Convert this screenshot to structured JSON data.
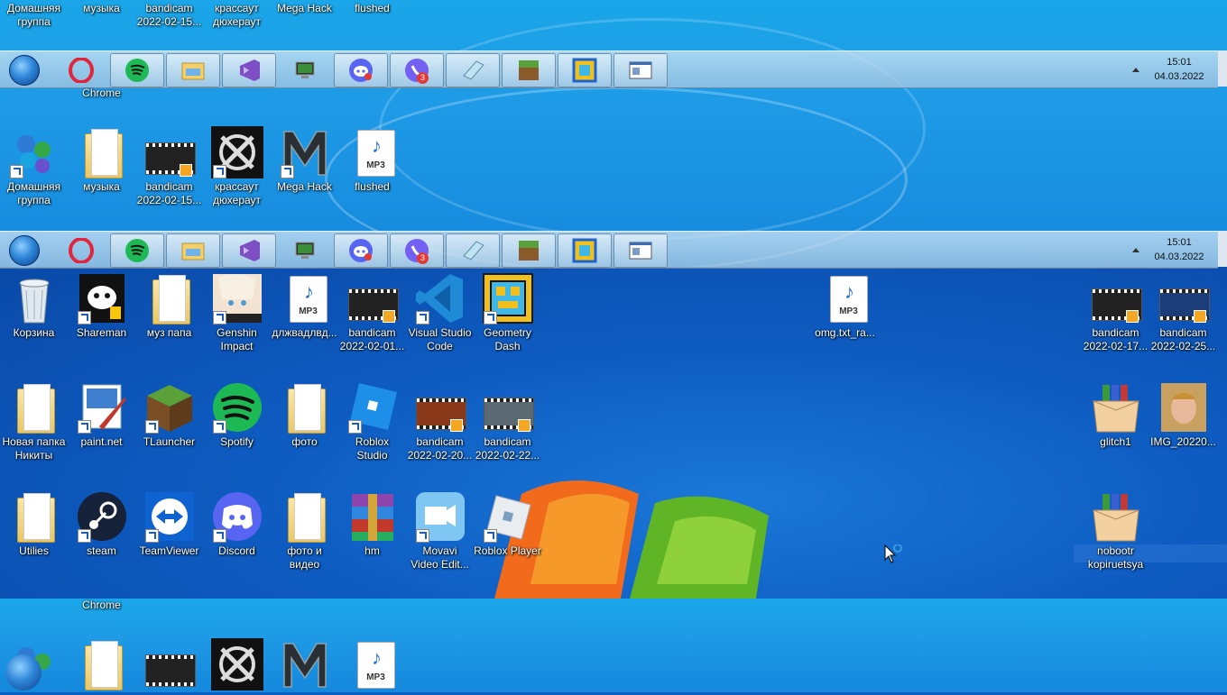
{
  "taskbar": {
    "clock_time": "15:01",
    "clock_date": "04.03.2022",
    "apps": [
      {
        "name": "opera-icon",
        "badge": ""
      },
      {
        "name": "spotify-icon",
        "badge": ""
      },
      {
        "name": "file-explorer-icon",
        "badge": ""
      },
      {
        "name": "visual-studio-icon",
        "badge": ""
      },
      {
        "name": "network-monitor-icon",
        "badge": ""
      },
      {
        "name": "discord-icon",
        "badge": ""
      },
      {
        "name": "viber-icon",
        "badge": "3"
      },
      {
        "name": "notepad-icon",
        "badge": ""
      },
      {
        "name": "minecraft-icon",
        "badge": ""
      },
      {
        "name": "geometry-dash-icon",
        "badge": ""
      },
      {
        "name": "window-app-icon",
        "badge": ""
      }
    ]
  },
  "ghost_top_labels": [
    "Домашняя\nгруппа",
    "музыка",
    "bandicam\n2022-02-15...",
    "крассаут\nдюхераут",
    "Mega Hack",
    "flushed"
  ],
  "ghost_chrome_label": "Chrome",
  "desktop": {
    "row1": [
      {
        "label": "Корзина",
        "icon": "recycle-bin-icon"
      },
      {
        "label": "Shareman",
        "icon": "shareman-icon"
      },
      {
        "label": "муз папа",
        "icon": "folder-icon"
      },
      {
        "label": "Genshin\nImpact",
        "icon": "genshin-icon"
      },
      {
        "label": "длжвадлвд...",
        "icon": "mp3-file-icon"
      },
      {
        "label": "bandicam\n2022-02-01...",
        "icon": "video-file-icon"
      },
      {
        "label": "Visual Studio\nCode",
        "icon": "vscode-icon"
      },
      {
        "label": "Geometry\nDash",
        "icon": "geometry-dash-icon"
      },
      {
        "label": "omg.txt_ra...",
        "icon": "mp3-file-icon"
      },
      {
        "label": "bandicam\n2022-02-17...",
        "icon": "video-file-icon"
      },
      {
        "label": "bandicam\n2022-02-25...",
        "icon": "video-file-icon"
      }
    ],
    "row2": [
      {
        "label": "Новая папка\nНикиты",
        "icon": "folder-icon"
      },
      {
        "label": "paint.net",
        "icon": "paintnet-icon"
      },
      {
        "label": "TLauncher",
        "icon": "minecraft-icon"
      },
      {
        "label": "Spotify",
        "icon": "spotify-icon"
      },
      {
        "label": "фото",
        "icon": "folder-icon"
      },
      {
        "label": "Roblox\nStudio",
        "icon": "roblox-studio-icon"
      },
      {
        "label": "bandicam\n2022-02-20...",
        "icon": "video-file-icon"
      },
      {
        "label": "bandicam\n2022-02-22...",
        "icon": "video-file-icon"
      },
      {
        "label": "glitch1",
        "icon": "archive-box-icon"
      },
      {
        "label": "IMG_20220...",
        "icon": "photo-icon"
      }
    ],
    "row3": [
      {
        "label": "Utilies",
        "icon": "folder-icon"
      },
      {
        "label": "steam",
        "icon": "steam-icon"
      },
      {
        "label": "TeamViewer",
        "icon": "teamviewer-icon"
      },
      {
        "label": "Discord",
        "icon": "discord-icon"
      },
      {
        "label": "фото и\nвидео",
        "icon": "folder-icon"
      },
      {
        "label": "hm",
        "icon": "winrar-icon"
      },
      {
        "label": "Movavi\nVideo Edit...",
        "icon": "movavi-icon"
      },
      {
        "label": "Roblox Player",
        "icon": "roblox-icon"
      },
      {
        "label": "nobootr\nkopiruetsya",
        "icon": "archive-box-icon"
      }
    ]
  }
}
